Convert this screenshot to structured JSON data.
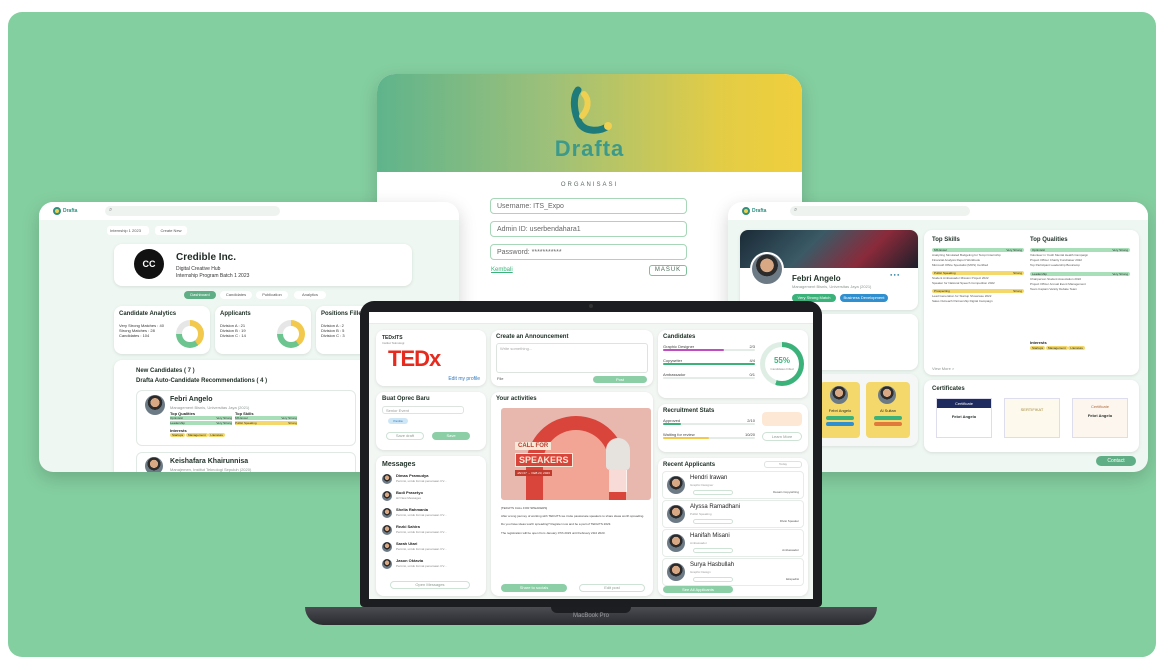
{
  "colors": {
    "brand_green": "#3ab27a",
    "background": "#84cfa0",
    "yellow": "#f2c94c"
  },
  "login": {
    "logo_text": "Drafta",
    "section_label": "ORGANISASI",
    "username": "Username: ITS_Expo",
    "admin_id": "Admin ID: userbendahara1",
    "password": "Password: ***********",
    "back_link": "Kembali",
    "submit": "MASUK"
  },
  "left": {
    "brand": "Drafta",
    "filter": "Internship 1 2023",
    "create_btn": "Create New",
    "company_name": "Credible Inc.",
    "company_logo": "CC",
    "company_sub1": "Digital Creative Hub",
    "company_sub2": "Internship Program Batch 1 2023",
    "tabs": [
      "Dashboard",
      "Candidates",
      "Publication",
      "Analytics"
    ],
    "analytics_title": "Candidate Analytics",
    "analytics_lines": [
      "Very Strong Matches : 40",
      "Strong Matches : 28",
      "Candidates : 104"
    ],
    "applicants_title": "Applicants",
    "applicants_lines": [
      "Division A : 21",
      "Division B : 19",
      "Division C : 14"
    ],
    "positions_title": "Positions Filled",
    "positions_lines": [
      "Division A : 2",
      "Division B : 5",
      "Division C : 3"
    ],
    "new_candidates": "New Candidates ( 7 )",
    "recommend": "Drafta Auto-Candidate Recommendations ( 4 )",
    "cand1_name": "Febri Angelo",
    "cand1_sub": "Management Bisnis, Universitas Jaya (2021)",
    "top_qualities": "Top Qualities",
    "top_skills": "Top Skills",
    "q_rows": [
      [
        "Optimistic",
        "Very Strong"
      ],
      [
        "Leadership",
        "Very Strong"
      ]
    ],
    "s_rows": [
      [
        "MS Excel",
        "Very Strong"
      ],
      [
        "Public Speaking",
        "Strong"
      ]
    ],
    "interests": "Interests",
    "interest_tags": [
      "Startups",
      "Management",
      "Literature"
    ],
    "cand2_name": "Keishafara Khairunnisa",
    "cand2_sub": "Manajemen, Institut Teknologi Sepuluh (2020)"
  },
  "right": {
    "brand": "Drafta",
    "profile_name": "Febri Angelo",
    "profile_sub": "Management Bisnis, Universitas Jaya (2021)",
    "btn_follow": "Very Strong Match",
    "btn_role": "Business Development",
    "top_skills": "Top Skills",
    "top_qualities": "Top Qualities",
    "skills": [
      {
        "name": "MS Excel",
        "level": "Very Strong",
        "items": [
          "Analyzing Simulated Budgeting for Tempi Internship",
          "Financial Analysis Report Workbook",
          "Microsoft Office Specialist (MOS) Certified"
        ]
      },
      {
        "name": "Public Speaking",
        "level": "Strong",
        "items": [
          "Student Ambassador Mission Project 2022",
          "Speaker for National Speech Competition 2022"
        ]
      },
      {
        "name": "Prospecting",
        "level": "Strong",
        "items": [
          "Lead Generation for Startup Showcase 2022",
          "Sales Outreach Partnership Digital Campaign"
        ]
      }
    ],
    "qualities": [
      {
        "name": "Optimistic",
        "level": "Very Strong",
        "items": [
          "Volunteer in Youth Mental Health Campaign",
          "Project Officer Charity Fundraiser 2022",
          "Top Participant Leadership Bootcamp"
        ]
      },
      {
        "name": "Leadership",
        "level": "Very Strong",
        "items": [
          "Chairperson Student Association 2022",
          "Project Officer Annual Event Management",
          "Team Captain Varsity Debate Team"
        ]
      }
    ],
    "interests": "Interests",
    "interest_tags": [
      "Startups",
      "Management",
      "Literature"
    ],
    "view_more": "View More >",
    "certificates": "Certificates",
    "cert_titles": [
      "Certificate",
      "SERTIFIKAT",
      "Certificate"
    ],
    "cert_name": "Febri Angelo",
    "contact": "Contact",
    "mini_names": [
      "Febri Angelo",
      "Al Sultan"
    ]
  },
  "laptop": {
    "model": "MacBook Pro",
    "org_name": "TEDxITS",
    "org_sub": "Institut Teknologi",
    "tedx_logo": "TEDx",
    "edit_profile": "Edit my profile",
    "announce_title": "Create an Announcement",
    "announce_placeholder": "Write something...",
    "announce_attach": "File",
    "announce_post": "Post",
    "candidates_title": "Candidates",
    "cand_rows": [
      [
        "Graphic Designer",
        "2/3"
      ],
      [
        "Copywriter",
        "4/4"
      ],
      [
        "Ambassador",
        "0/1"
      ]
    ],
    "gauge_value": "55%",
    "gauge_label": "Candidates Filled",
    "opportunity_title": "Buat Oprec Baru",
    "opportunity_input": "Senior Event",
    "opportunity_tag": "Panitia",
    "opportunity_btn1": "Save draft",
    "opportunity_btn2": "Save",
    "activities_title": "Your activities",
    "poster_text1": "CALL FOR",
    "poster_text2": "SPEAKERS",
    "poster_date": "JAN 07 → FEB 23, 2023",
    "activity_lines": [
      "[TEDxITS CALL FOR SPEAKERS]",
      "After a long journey of working with TEDxITS we invite passionate speakers to share ideas worth spreading.",
      "Do you have ideas worth spreading? Register now and be a part of TEDxITS 2023.",
      "The registration will be open from January 07th 2023 until February 23rd 2023."
    ],
    "activity_btn1": "Share to socials",
    "activity_btn2": "Edit post",
    "recruit_title": "Recruitment Stats",
    "recruit_rows": [
      [
        "Approved",
        "2/10"
      ],
      [
        "Waiting for review",
        "10/20"
      ]
    ],
    "recruit_btn": "Learn More",
    "messages_title": "Messages",
    "messages": [
      [
        "Dimas Pramudya",
        "Permisi, untuk format penamaan CV..."
      ],
      [
        "Budi Prasetyo",
        "Hi! New Messages"
      ],
      [
        "Shelia Rahmania",
        "Permisi, untuk format penamaan CV..."
      ],
      [
        "Rezki Sahira",
        "Permisi, untuk format penamaan CV..."
      ],
      [
        "Sarah Utari",
        "Permisi, untuk format penamaan CV..."
      ],
      [
        "Jason Oktavia",
        "Permisi, untuk format penamaan CV..."
      ]
    ],
    "messages_btn": "Open Messages",
    "recent_title": "Recent Applicants",
    "recent_filter": "Today",
    "applicants": [
      [
        "Hendri Irawan",
        "Graphic Designer",
        "Desain Copywriting"
      ],
      [
        "Alyssa Ramadhani",
        "Public Speaking",
        "Divisi Speaker"
      ],
      [
        "Hanifah Misani",
        "Ambassador",
        "Ambassador"
      ],
      [
        "Surya Hasbullah",
        "Graphic Design",
        "Ekspedisi"
      ]
    ],
    "applicants_btn": "See All Applicants"
  }
}
